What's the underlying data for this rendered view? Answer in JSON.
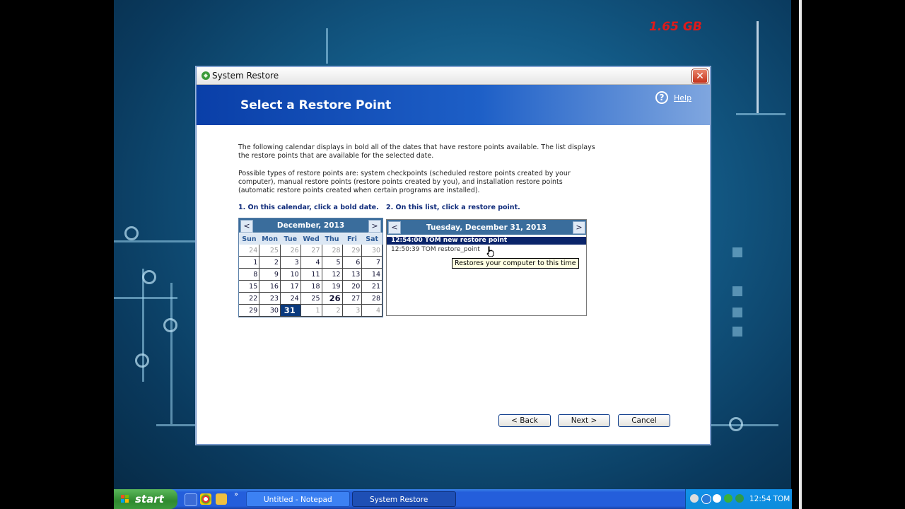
{
  "overlay": {
    "memory": "1.65 GB"
  },
  "dialog": {
    "title": "System Restore",
    "page_title": "Select a Restore Point",
    "help": "Help",
    "para1": "The following calendar displays in bold all of the dates that have restore points available. The list displays the restore points that are available for the selected date.",
    "para2": "Possible types of restore points are: system checkpoints (scheduled restore points created by your computer), manual restore points (restore points created by you), and installation restore points (automatic restore points created when certain programs are installed).",
    "step1": "1. On this calendar, click a bold date.",
    "step2": "2. On this list, click a restore point.",
    "calendar": {
      "month": "December, 2013",
      "prev": "<",
      "next": ">",
      "days": [
        "Sun",
        "Mon",
        "Tue",
        "Wed",
        "Thu",
        "Fri",
        "Sat"
      ],
      "weeks": [
        [
          "24",
          "25",
          "26",
          "27",
          "28",
          "29",
          "30"
        ],
        [
          "1",
          "2",
          "3",
          "4",
          "5",
          "6",
          "7"
        ],
        [
          "8",
          "9",
          "10",
          "11",
          "12",
          "13",
          "14"
        ],
        [
          "15",
          "16",
          "17",
          "18",
          "19",
          "20",
          "21"
        ],
        [
          "22",
          "23",
          "24",
          "25",
          "26",
          "27",
          "28"
        ],
        [
          "29",
          "30",
          "31",
          "1",
          "2",
          "3",
          "4"
        ]
      ],
      "bold_date": "26",
      "selected_date": "31"
    },
    "restore_list": {
      "date": "Tuesday, December 31, 2013",
      "prev": "<",
      "next": ">",
      "items": [
        {
          "time": "12:54:00 TOM",
          "name": "new restore point",
          "selected": true
        },
        {
          "time": "12:50:39 TOM",
          "name": "restore_point",
          "selected": false
        }
      ],
      "tooltip": "Restores your computer to this time"
    },
    "buttons": {
      "back": "< Back",
      "next": "Next >",
      "cancel": "Cancel"
    }
  },
  "taskbar": {
    "start": "start",
    "tasks": [
      "Untitled - Notepad",
      "System Restore"
    ],
    "clock": "12:54 TOM"
  }
}
